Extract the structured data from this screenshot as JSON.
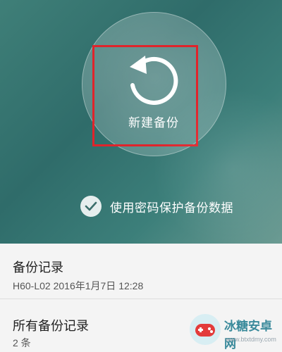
{
  "backup": {
    "new_backup_label": "新建备份",
    "icon": "refresh-icon"
  },
  "password_option": {
    "label": "使用密码保护备份数据",
    "checked": true,
    "icon": "check-icon"
  },
  "records": {
    "title": "备份记录",
    "latest": "H60-L02  2016年1月7日 12:28"
  },
  "all_records": {
    "title": "所有备份记录",
    "count": "2 条"
  },
  "watermark": {
    "name": "冰糖安卓网",
    "url": "www.btxtdmy.com"
  },
  "colors": {
    "hero_teal": "#2f6c6a",
    "highlight_red": "#e0242b",
    "watermark_blue": "#3a8a9b"
  }
}
